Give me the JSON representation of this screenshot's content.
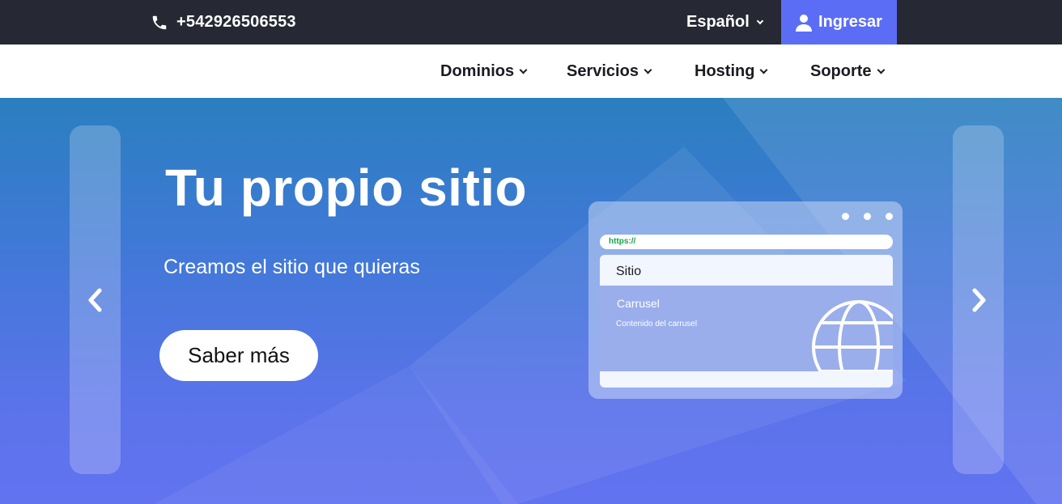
{
  "topbar": {
    "phone_icon": "phone-icon",
    "phone": "+542926506553",
    "language": "Español",
    "login_icon": "user-icon",
    "login_label": "Ingresar"
  },
  "nav": {
    "items": [
      {
        "label": "Dominios"
      },
      {
        "label": "Servicios"
      },
      {
        "label": "Hosting"
      },
      {
        "label": "Soporte"
      }
    ]
  },
  "hero": {
    "title": "Tu propio sitio",
    "subtitle": "Creamos el sitio que quieras",
    "cta": "Saber más",
    "prev_icon": "chevron-left-icon",
    "next_icon": "chevron-right-icon"
  },
  "browser_mock": {
    "url": "https://",
    "panel_title": "Sitio",
    "carousel_title": "Carrusel",
    "carousel_text": "Contenido del carrusel",
    "globe_icon": "globe-icon"
  },
  "colors": {
    "topbar_bg": "#262834",
    "accent": "#5b6df5",
    "hero_top": "#2a7fbf",
    "hero_bottom": "#6273f0",
    "url_green": "#1aa34a"
  }
}
